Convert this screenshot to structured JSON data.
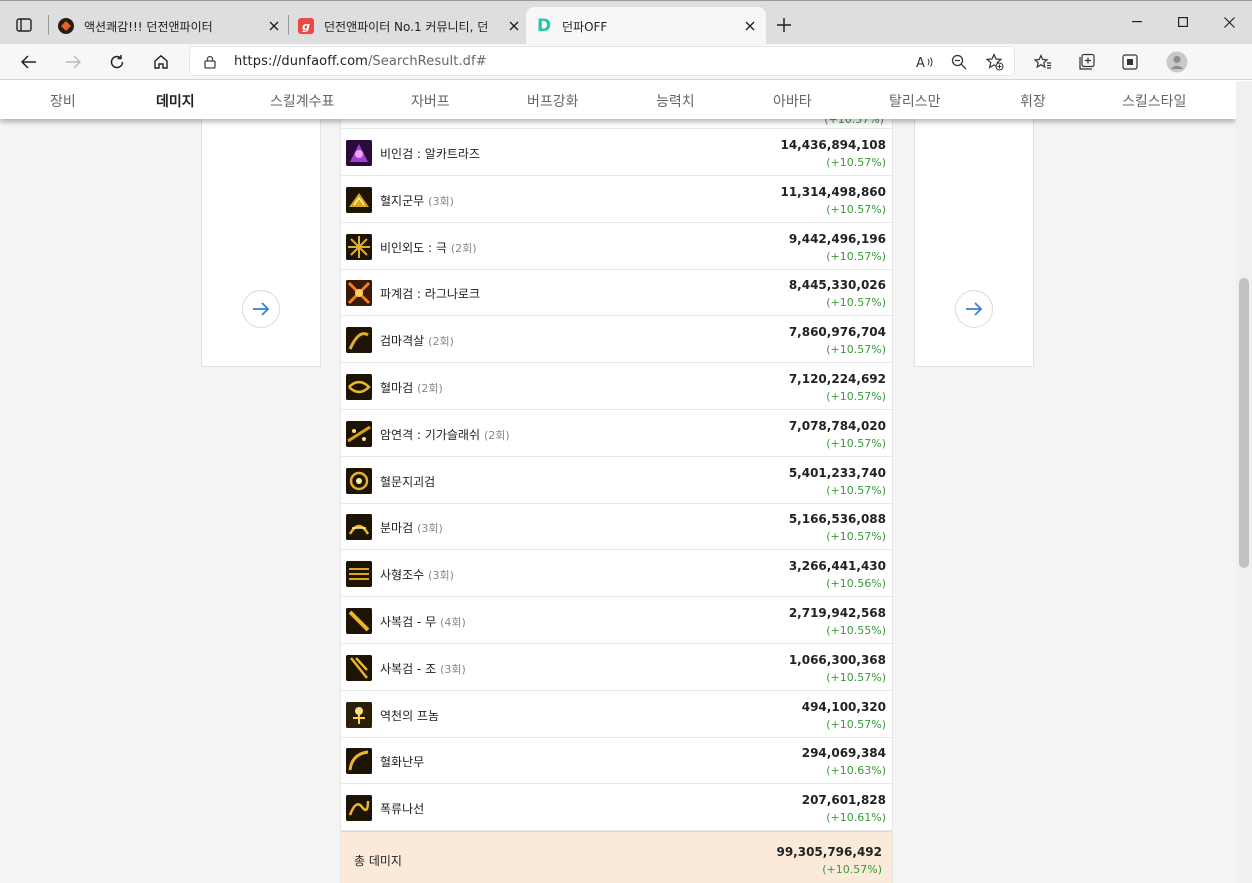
{
  "browser": {
    "tabs": [
      {
        "title": "액션쾌감!!! 던전앤파이터",
        "favicon": "dnf-game-icon"
      },
      {
        "title": "던전앤파이터 No.1 커뮤니티, 던",
        "favicon": "community-g-icon"
      },
      {
        "title": "던파OFF",
        "favicon": "dunfaoff-d-icon"
      }
    ],
    "url_host": "https://dunfaoff.com",
    "url_path": "/SearchResult.df#"
  },
  "subnav": {
    "items": [
      "장비",
      "데미지",
      "스킬계수표",
      "자버프",
      "버프강화",
      "능력치",
      "아바타",
      "탈리스만",
      "휘장",
      "스킬스타일"
    ],
    "active": "데미지"
  },
  "skills": [
    {
      "name": "비인검 : 알카트라즈",
      "count": "",
      "damage": "14,436,894,108",
      "pct": "(+10.57%)"
    },
    {
      "name": "혈지군무",
      "count": "(3회)",
      "damage": "11,314,498,860",
      "pct": "(+10.57%)"
    },
    {
      "name": "비인외도 : 극",
      "count": "(2회)",
      "damage": "9,442,496,196",
      "pct": "(+10.57%)"
    },
    {
      "name": "파계검 : 라그나로크",
      "count": "",
      "damage": "8,445,330,026",
      "pct": "(+10.57%)"
    },
    {
      "name": "검마격살",
      "count": "(2회)",
      "damage": "7,860,976,704",
      "pct": "(+10.57%)"
    },
    {
      "name": "혈마검",
      "count": "(2회)",
      "damage": "7,120,224,692",
      "pct": "(+10.57%)"
    },
    {
      "name": "암연격 : 기가슬래쉬",
      "count": "(2회)",
      "damage": "7,078,784,020",
      "pct": "(+10.57%)"
    },
    {
      "name": "혈문지괴검",
      "count": "",
      "damage": "5,401,233,740",
      "pct": "(+10.57%)"
    },
    {
      "name": "분마검",
      "count": "(3회)",
      "damage": "5,166,536,088",
      "pct": "(+10.57%)"
    },
    {
      "name": "사형조수",
      "count": "(3회)",
      "damage": "3,266,441,430",
      "pct": "(+10.56%)"
    },
    {
      "name": "사복검 - 무",
      "count": "(4회)",
      "damage": "2,719,942,568",
      "pct": "(+10.55%)"
    },
    {
      "name": "사복검 - 조",
      "count": "(3회)",
      "damage": "1,066,300,368",
      "pct": "(+10.57%)"
    },
    {
      "name": "역천의 프놈",
      "count": "",
      "damage": "494,100,320",
      "pct": "(+10.57%)"
    },
    {
      "name": "혈화난무",
      "count": "",
      "damage": "294,069,384",
      "pct": "(+10.63%)"
    },
    {
      "name": "폭류나선",
      "count": "",
      "damage": "207,601,828",
      "pct": "(+10.61%)"
    }
  ],
  "total": {
    "label": "총 데미지",
    "damage": "99,305,796,492",
    "pct": "(+10.57%)"
  },
  "colors": {
    "gain": "#3a9a3a",
    "total_bg": "#fbeada",
    "arrow": "#3a7fd5"
  }
}
